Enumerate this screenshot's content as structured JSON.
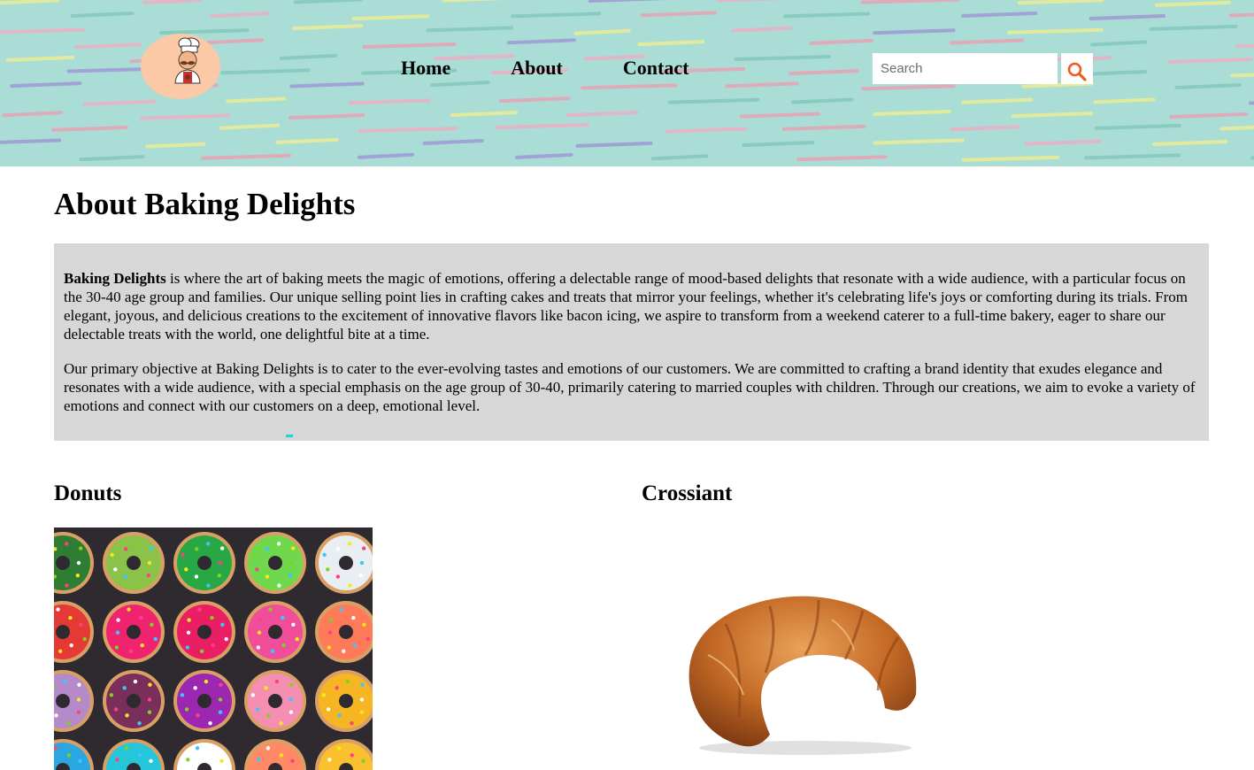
{
  "header": {
    "logo_icon": "chef-mascot-icon",
    "nav": [
      {
        "label": "Home"
      },
      {
        "label": "About"
      },
      {
        "label": "Contact"
      }
    ],
    "search": {
      "placeholder": "Search",
      "button_icon": "search-icon",
      "accent_color": "#f15a24"
    },
    "background_color": "#a9ddd6"
  },
  "main": {
    "title": "About Baking Delights",
    "about": {
      "brand": "Baking Delights",
      "paragraph1_rest": " is where the art of baking meets the magic of emotions, offering a delectable range of mood-based delights that resonate with a wide audience, with a particular focus on the 30-40 age group and families. Our unique selling point lies in crafting cakes and treats that mirror your feelings, whether it's celebrating life's joys or comforting during its trials. From elegant, joyous, and delicious creations to the excitement of innovative flavors like bacon icing, we aspire to transform from a weekend caterer to a full-time bakery, eager to share our delectable treats with the world, one delightful bite at a time.",
      "paragraph2": "Our primary objective at Baking Delights is to cater to the ever-evolving tastes and emotions of our customers. We are committed to crafting a brand identity that exudes elegance and resonates with a wide audience, with a special emphasis on the age group of 30-40, primarily catering to married couples with children. Through our creations, we aim to evoke a variety of emotions and connect with our customers on a deep, emotional level.",
      "background_color": "#d7d7d7"
    },
    "products": [
      {
        "title": "Donuts",
        "image": "donuts-photo"
      },
      {
        "title": "Crossiant",
        "image": "croissant-photo"
      }
    ]
  }
}
